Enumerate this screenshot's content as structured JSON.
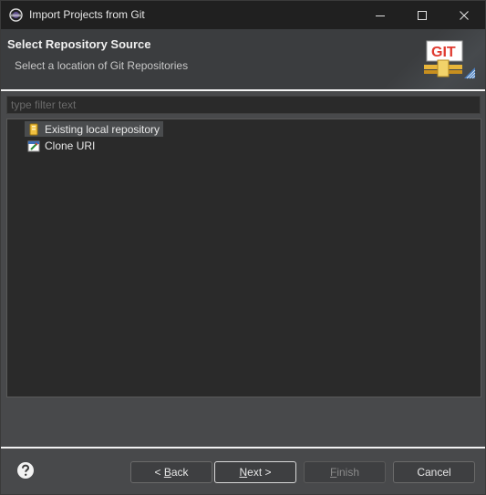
{
  "window": {
    "title": "Import Projects from Git"
  },
  "banner": {
    "title": "Select Repository Source",
    "subtitle": "Select a location of Git Repositories",
    "logo_text": "GIT"
  },
  "filter": {
    "placeholder": "type filter text",
    "value": ""
  },
  "tree": {
    "items": [
      {
        "label": "Existing local repository",
        "icon": "repository-icon",
        "selected": true
      },
      {
        "label": "Clone URI",
        "icon": "clone-uri-icon",
        "selected": false
      }
    ]
  },
  "buttons": {
    "back": {
      "pre": "< ",
      "mnemonic": "B",
      "post": "ack"
    },
    "next": {
      "mnemonic": "N",
      "post": "ext >"
    },
    "finish": {
      "mnemonic": "F",
      "post": "inish",
      "enabled": false
    },
    "cancel": {
      "label": "Cancel"
    }
  },
  "colors": {
    "background": "#48494b",
    "banner": "#3b3d3f",
    "titlebar": "#202020",
    "field": "#2a2a2a",
    "selection": "#4a4c4e",
    "git_red": "#e03a2f",
    "git_green": "#2aa84a"
  }
}
